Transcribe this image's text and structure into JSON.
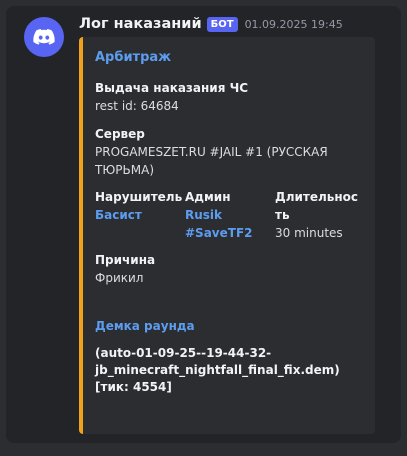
{
  "message": {
    "username": "Лог наказаний",
    "bot_tag": "БОТ",
    "timestamp": "01.09.2025 19:45",
    "avatar_icon": "discord-logo-icon"
  },
  "embed": {
    "accent_color": "#f0a21b",
    "title": "Арбитраж",
    "action": {
      "title": "Выдача наказания ЧС",
      "rest_id": "rest id: 64684"
    },
    "server": {
      "name": "Сервер",
      "value_line1": "PROGAMESZET.RU #JAIL #1 (РУССКАЯ",
      "value_line2": "ТЮРЬМА)"
    },
    "violator": {
      "name": "Нарушитель",
      "value": "Басист"
    },
    "admin": {
      "name": "Админ",
      "value_line1": "Rusik",
      "value_line2": "#SaveTF2"
    },
    "duration": {
      "name_line1": "Длительнос",
      "name_line2": "ть",
      "value": "30 minutes"
    },
    "reason": {
      "name": "Причина",
      "value": "Фрикил"
    },
    "demo": {
      "link": "Демка раунда",
      "line1": "(auto-01-09-25--19-44-32-",
      "line2": "jb_minecraft_nightfall_final_fix.dem)",
      "line3": "[тик: 4554]"
    }
  }
}
